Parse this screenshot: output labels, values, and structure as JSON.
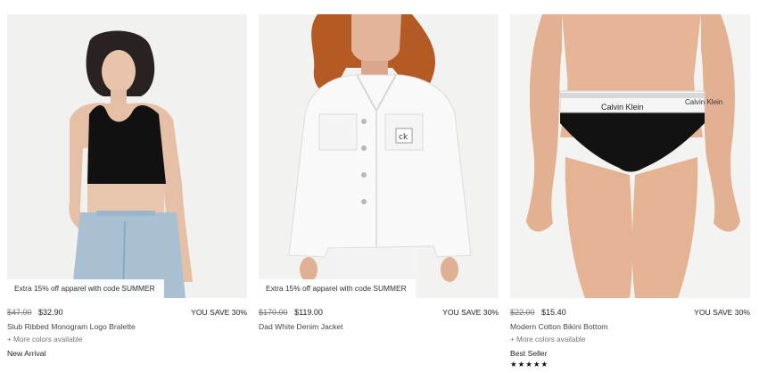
{
  "colors": {
    "text": "#222222",
    "muted": "#777777",
    "image_bg": "#f3f3f1"
  },
  "products": [
    {
      "promo": "Extra 15% off apparel with code SUMMER",
      "price_old": "$47.00",
      "price_new": "$32.90",
      "save": "YOU SAVE 30%",
      "name": "Slub Ribbed Monogram Logo Bralette",
      "more_colors": "+ More colors available",
      "badge": "New Arrival",
      "image_desc": "model wearing black bralette and light blue jeans"
    },
    {
      "promo": "Extra 15% off apparel with code SUMMER",
      "price_old": "$170.00",
      "price_new": "$119.00",
      "save": "YOU SAVE 30%",
      "name": "Dad White Denim Jacket",
      "image_desc": "model wearing white denim jacket"
    },
    {
      "price_old": "$22.00",
      "price_new": "$15.40",
      "save": "YOU SAVE 30%",
      "name": "Modern Cotton Bikini Bottom",
      "more_colors": "+ More colors available",
      "badge": "Best Seller",
      "rating_stars": "★★★★★",
      "image_logo_text": "Calvin Klein",
      "image_desc": "model wearing black bikini bottom with white logo waistband"
    }
  ]
}
